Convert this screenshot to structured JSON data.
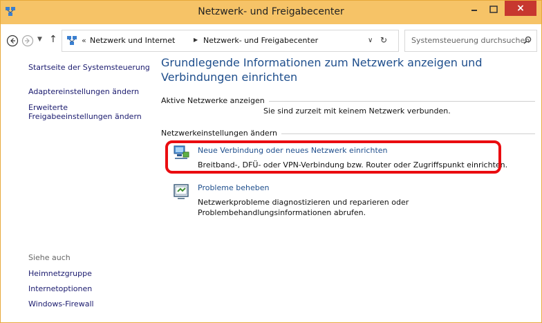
{
  "window": {
    "title": "Netzwerk- und Freigabecenter",
    "close_glyph": "×",
    "accent_color": "#f6c367",
    "close_color": "#c7372f"
  },
  "addressbar": {
    "overflow": "«",
    "crumbs": [
      "Netzwerk und Internet",
      "Netzwerk- und Freigabecenter"
    ],
    "search_placeholder": "Systemsteuerung durchsuchen"
  },
  "sidebar": {
    "home": "Startseite der Systemsteuerung",
    "adapter": "Adaptereinstellungen ändern",
    "sharing": [
      "Erweiterte",
      "Freigabeeinstellungen ändern"
    ],
    "see_also_heading": "Siehe auch",
    "see_also": [
      "Heimnetzgruppe",
      "Internetoptionen",
      "Windows-Firewall"
    ]
  },
  "main": {
    "heading": "Grundlegende Informationen zum Netzwerk anzeigen und Verbindungen einrichten",
    "active_networks_label": "Aktive Netzwerke anzeigen",
    "no_network_text": "Sie sind zurzeit mit keinem Netzwerk verbunden.",
    "settings_label": "Netzwerkeinstellungen ändern",
    "tasks": [
      {
        "link": "Neue Verbindung oder neues Netzwerk einrichten",
        "desc": "Breitband-, DFÜ- oder VPN-Verbindung bzw. Router oder Zugriffspunkt einrichten."
      },
      {
        "link": "Probleme beheben",
        "desc": "Netzwerkprobleme diagnostizieren und reparieren oder Problembehandlungsinformationen abrufen."
      }
    ],
    "highlight_color": "#ea0c10"
  }
}
